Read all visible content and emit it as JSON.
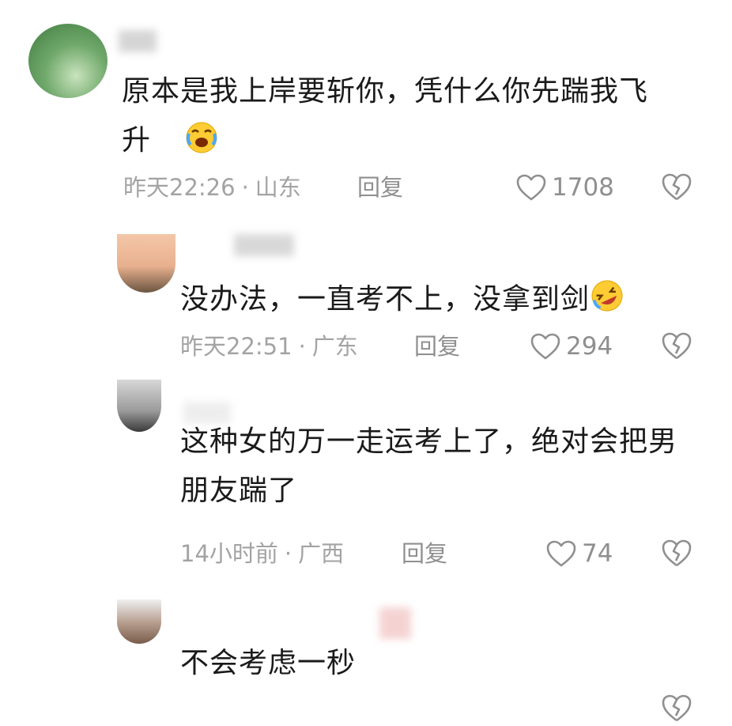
{
  "comments": [
    {
      "text_lines": [
        "原本是我上岸要斩你，凭什么你先踹我飞",
        "升"
      ],
      "time": "昨天22:26",
      "location": "山东",
      "reply_label": "回复",
      "likes": "1708",
      "emoji": "crying-laughing-emoji"
    },
    {
      "text_lines": [
        "没办法，一直考不上，没拿到剑"
      ],
      "time": "昨天22:51",
      "location": "广东",
      "reply_label": "回复",
      "likes": "294",
      "emoji": "rofl-emoji"
    },
    {
      "text_lines": [
        "这种女的万一走运考上了，绝对会把男",
        "朋友踹了"
      ],
      "time": "14小时前",
      "location": "广西",
      "reply_label": "回复",
      "likes": "74"
    },
    {
      "text_lines": [
        "不会考虑一秒"
      ]
    }
  ],
  "separator": "·",
  "colors": {
    "text": "#1a1a1a",
    "meta": "#a3a3a3",
    "icon": "#8f8f8f"
  }
}
